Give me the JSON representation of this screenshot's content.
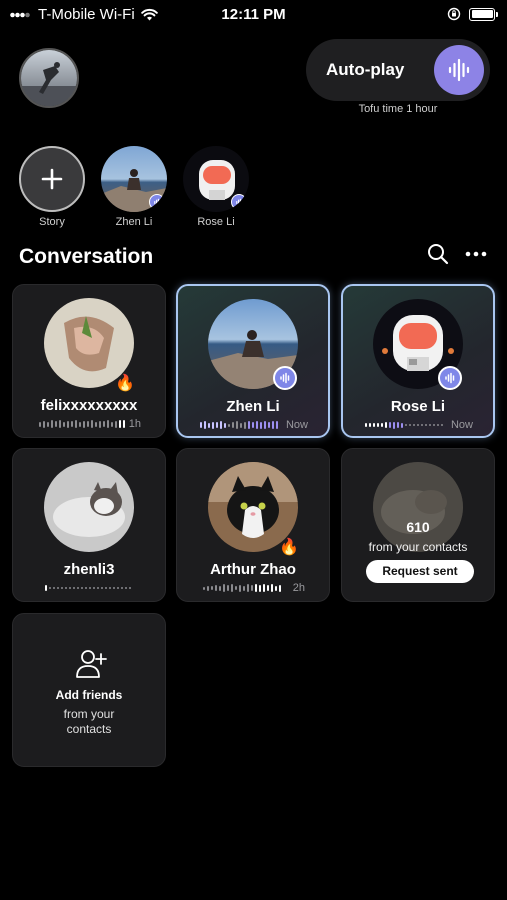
{
  "status_bar": {
    "carrier": "T-Mobile Wi-Fi",
    "time": "12:11 PM"
  },
  "autoplay": {
    "label": "Auto-play",
    "note": "Tofu time 1 hour"
  },
  "stories": [
    {
      "name": "Story"
    },
    {
      "name": "Zhen Li"
    },
    {
      "name": "Rose Li"
    }
  ],
  "section": {
    "title": "Conversation"
  },
  "cards": [
    {
      "name": "felixxxxxxxxx",
      "meta": "1h"
    },
    {
      "name": "Zhen Li",
      "meta": "Now"
    },
    {
      "name": "Rose Li",
      "meta": "Now"
    },
    {
      "name": "zhenli3",
      "meta": ""
    },
    {
      "name": "Arthur Zhao",
      "meta": "2h"
    }
  ],
  "contacts_card": {
    "count": "610",
    "subtitle": "from your contacts",
    "button": "Request sent"
  },
  "add_friends": {
    "title": "Add friends",
    "subtitle_line1": "from your",
    "subtitle_line2": "contacts"
  },
  "colors": {
    "accent": "#8d83e6",
    "badge": "#7f87e8",
    "card_bg": "#1c1c1e",
    "active_border": "#a9c6f0"
  }
}
